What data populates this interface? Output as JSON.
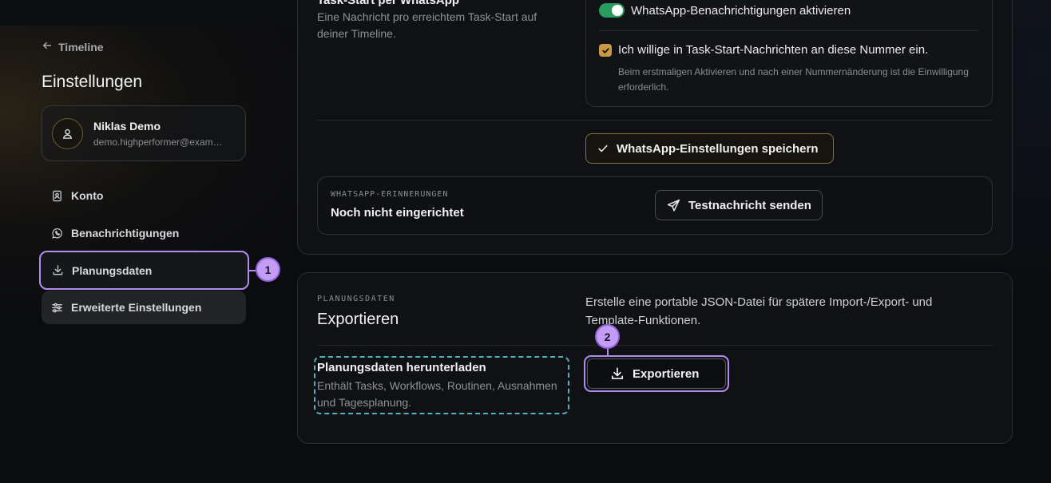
{
  "sidebar": {
    "back_link": "Timeline",
    "title": "Einstellungen",
    "profile": {
      "name": "Niklas Demo",
      "email": "demo.highperformer@exam…"
    },
    "items": [
      {
        "label": "Konto",
        "icon": "id-card-icon"
      },
      {
        "label": "Benachrichtigungen",
        "icon": "whatsapp-icon"
      },
      {
        "label": "Planungsdaten",
        "icon": "download-icon",
        "active": true
      },
      {
        "label": "Erweiterte Einstellungen",
        "icon": "sliders-icon"
      }
    ]
  },
  "whatsapp": {
    "section_title": "Task-Start per WhatsApp",
    "section_desc": "Eine Nachricht pro erreichtem Task-Start auf deiner Timeline.",
    "toggle_label": "WhatsApp-Benachrichtigungen aktivieren",
    "toggle_on": true,
    "consent_label": "Ich willige in Task-Start-Nachrichten an diese Nummer ein.",
    "consent_checked": true,
    "consent_hint": "Beim erstmaligen Aktivieren und nach einer Nummernänderung ist die Einwilligung erforderlich.",
    "save_button": "WhatsApp-Einstellungen speichern",
    "reminder_kicker": "WHATSAPP-ERINNERUNGEN",
    "reminder_status": "Noch nicht eingerichtet",
    "test_button": "Testnachricht senden"
  },
  "export": {
    "kicker": "PLANUNGSDATEN",
    "title": "Exportieren",
    "description": "Erstelle eine portable JSON-Datei für spätere Import-/Export- und Template-Funktionen.",
    "download_title": "Planungsdaten herunterladen",
    "download_desc": "Enthält Tasks, Workflows, Routinen, Ausnahmen und Tagesplanung.",
    "export_button": "Exportieren"
  },
  "annotations": {
    "badge_1": "1",
    "badge_2": "2"
  },
  "colors": {
    "accent_purple": "#b48cf0",
    "gold": "#c89a45",
    "toggle_green": "#2a9d5e",
    "dashed_cyan": "#4fb3c0"
  }
}
